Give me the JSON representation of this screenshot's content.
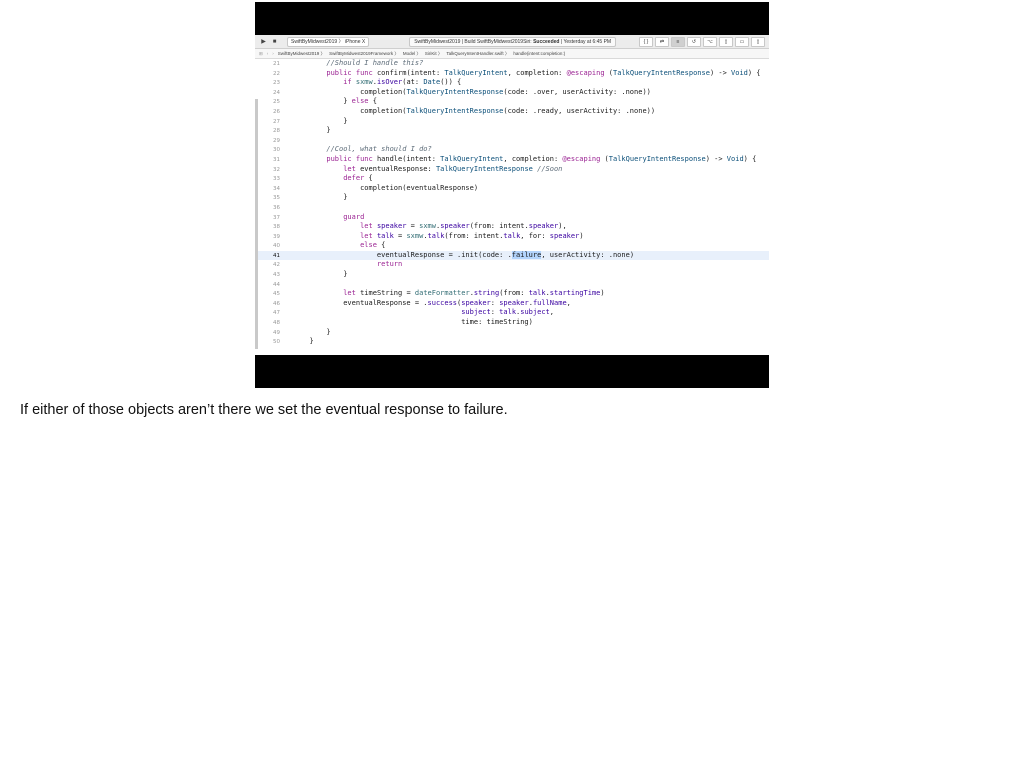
{
  "toolbar": {
    "play_icon": "play-icon",
    "stop_icon": "stop-icon",
    "scheme": "SwiftByMidwest2019",
    "device": "iPhone X",
    "status_prefix": "SwiftByMidwest2019 | Build SwiftByMidwest2019Siri:",
    "status_result": "Succeeded",
    "status_time": "| Yesterday at 6:45 PM"
  },
  "jumpbar": {
    "items": [
      "SwiftByMidwest2019",
      "SwiftByMidwest2019Framework",
      "Model",
      "SiriKit",
      "TalkQueryIntentHandler.swift",
      "handle(intent:completion:)"
    ]
  },
  "code_lines": [
    {
      "n": "21",
      "t": "        //Should I handle this?"
    },
    {
      "n": "22",
      "t": "        public func confirm(intent: TalkQueryIntent, completion: @escaping (TalkQueryIntentResponse) -> Void) {"
    },
    {
      "n": "23",
      "t": "            if sxmw.isOver(at: Date()) {"
    },
    {
      "n": "24",
      "t": "                completion(TalkQueryIntentResponse(code: .over, userActivity: .none))"
    },
    {
      "n": "25",
      "t": "            } else {"
    },
    {
      "n": "26",
      "t": "                completion(TalkQueryIntentResponse(code: .ready, userActivity: .none))"
    },
    {
      "n": "27",
      "t": "            }"
    },
    {
      "n": "28",
      "t": "        }"
    },
    {
      "n": "29",
      "t": ""
    },
    {
      "n": "30",
      "t": "        //Cool, what should I do?"
    },
    {
      "n": "31",
      "t": "        public func handle(intent: TalkQueryIntent, completion: @escaping (TalkQueryIntentResponse) -> Void) {"
    },
    {
      "n": "32",
      "t": "            let eventualResponse: TalkQueryIntentResponse //Soon"
    },
    {
      "n": "33",
      "t": "            defer {"
    },
    {
      "n": "34",
      "t": "                completion(eventualResponse)"
    },
    {
      "n": "35",
      "t": "            }"
    },
    {
      "n": "36",
      "t": ""
    },
    {
      "n": "37",
      "t": "            guard"
    },
    {
      "n": "38",
      "t": "                let speaker = sxmw.speaker(from: intent.speaker),"
    },
    {
      "n": "39",
      "t": "                let talk = sxmw.talk(from: intent.talk, for: speaker)"
    },
    {
      "n": "40",
      "t": "                else {"
    },
    {
      "n": "41",
      "t": "                    eventualResponse = .init(code: .failure, userActivity: .none)"
    },
    {
      "n": "42",
      "t": "                    return"
    },
    {
      "n": "43",
      "t": "            }"
    },
    {
      "n": "44",
      "t": ""
    },
    {
      "n": "45",
      "t": "            let timeString = dateFormatter.string(from: talk.startingTime)"
    },
    {
      "n": "46",
      "t": "            eventualResponse = .success(speaker: speaker.fullName,"
    },
    {
      "n": "47",
      "t": "                                        subject: talk.subject,"
    },
    {
      "n": "48",
      "t": "                                        time: timeString)"
    },
    {
      "n": "49",
      "t": "        }"
    },
    {
      "n": "50",
      "t": "    }"
    }
  ],
  "current_line": "41",
  "caption": "If either of those objects aren’t there we set the eventual response to failure."
}
